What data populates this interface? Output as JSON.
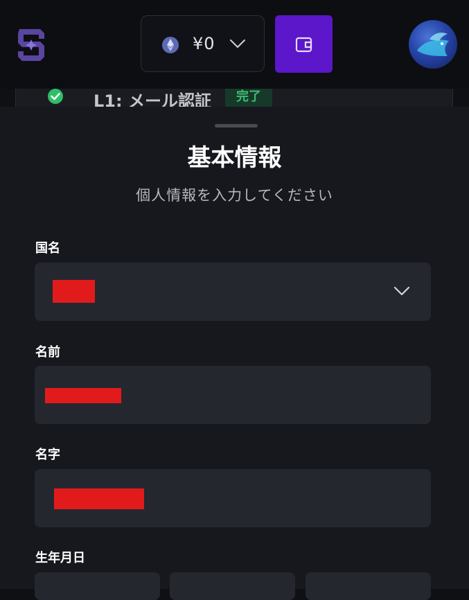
{
  "header": {
    "balance": "¥0",
    "icons": {
      "logo": "brand-logo-icon",
      "currency": "ethereum-icon",
      "dropdown": "chevron-down-icon",
      "wallet": "wallet-icon",
      "avatar": "user-avatar"
    },
    "colors": {
      "wallet_button": "#5b17c9",
      "logo": "#6a4fb0"
    }
  },
  "progress_step": {
    "label": "L1: メール認証",
    "status": "完了",
    "icon": "check-circle-icon",
    "status_color": "#3ebe70"
  },
  "form": {
    "title": "基本情報",
    "subtitle": "個人情報を入力してください",
    "fields": {
      "country": {
        "label": "国名",
        "value_redacted": true
      },
      "first_name": {
        "label": "名前",
        "value_redacted": true
      },
      "last_name": {
        "label": "名字",
        "value_redacted": true
      },
      "birthdate": {
        "label": "生年月日"
      }
    },
    "redaction_color": "#e11b1b"
  }
}
